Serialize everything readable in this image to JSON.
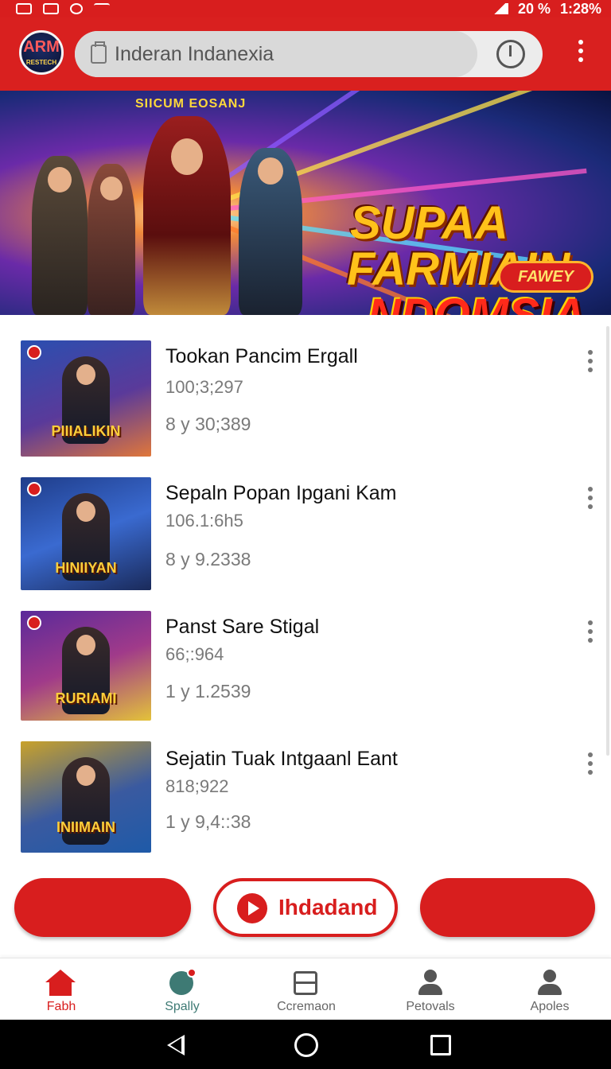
{
  "status_bar": {
    "battery": "20 %",
    "time": "1:28%"
  },
  "header": {
    "logo_text": "ARM",
    "logo_subtext": "RESTECH",
    "search_placeholder": "Inderan Indanexia"
  },
  "banner": {
    "subtitle": "SIICUM EOSANJ",
    "title_line1": "SUPAA",
    "title_line2": "FARMIAIN",
    "title_line3": "NDOMSIA",
    "button_label": "FAWEY"
  },
  "list": {
    "items": [
      {
        "title": "Tookan Pancim Ergall",
        "meta1": "100;3;297",
        "meta2": "8  y  30;389",
        "thumb_caption": "PIIIALIKIN",
        "thumb_colors": [
          "#2a4fb0",
          "#e0773a"
        ]
      },
      {
        "title": "Sepaln Popan Ipgani Kam",
        "meta1": "106.1:6h5",
        "meta2": "8  y  9.2338",
        "thumb_caption": "HINIIYAN",
        "thumb_colors": [
          "#1f3d8a",
          "#3a6ad0"
        ]
      },
      {
        "title": "Panst Sare Stigal",
        "meta1": "66;:964",
        "meta2": "1  y  1.2539",
        "thumb_caption": "RURIAMI",
        "thumb_colors": [
          "#5a2a9a",
          "#e3c23a"
        ]
      },
      {
        "title": "Sejatin Tuak Intgaanl Eant",
        "meta1": "818;922",
        "meta2": "1  y  9,4::38",
        "thumb_caption": "INIIMAIN",
        "thumb_colors": [
          "#c9a22a",
          "#1e5aa8"
        ]
      }
    ]
  },
  "actions": {
    "center_label": "Ihdadand"
  },
  "bottom_nav": {
    "items": [
      {
        "label": "Fabh",
        "icon": "home-icon"
      },
      {
        "label": "Spally",
        "icon": "spally-icon"
      },
      {
        "label": "Ccremaon",
        "icon": "box-icon"
      },
      {
        "label": "Petovals",
        "icon": "person-icon"
      },
      {
        "label": "Apoles",
        "icon": "person-icon"
      }
    ]
  },
  "colors": {
    "accent": "#d81e1e",
    "text_muted": "#7a7a7a"
  }
}
